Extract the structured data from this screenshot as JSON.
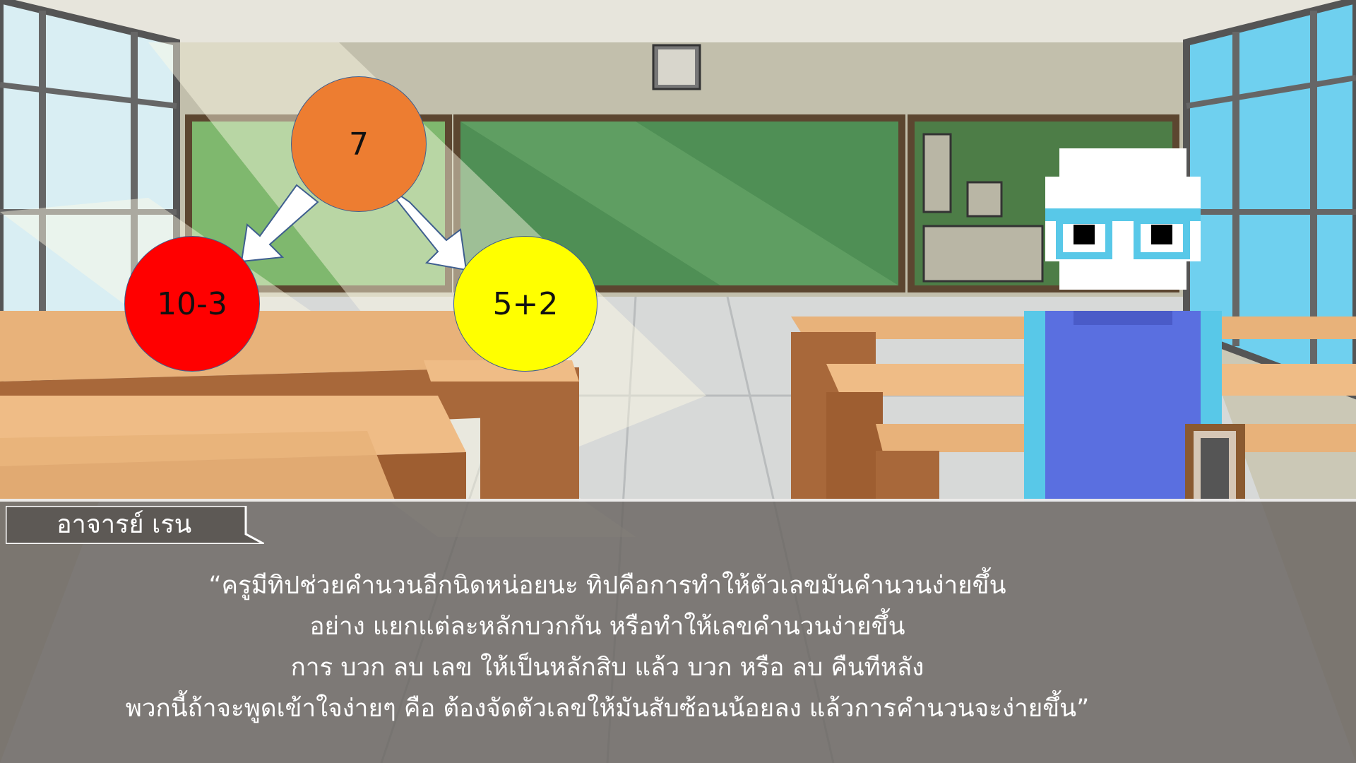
{
  "speaker": {
    "name": "อาจารย์ เรน"
  },
  "dialog": {
    "lines": [
      "“ครูมีทิปช่วยคำนวนอีกนิดหน่อยนะ ทิปคือการทำให้ตัวเลขมันคำนวนง่ายขึ้น",
      "อย่าง แยกแต่ละหลักบวกกัน หรือทำให้เลขคำนวนง่ายขึ้น",
      "การ บวก ลบ เลข ให้เป็นหลักสิบ แล้ว บวก หรือ ลบ คืนทีหลัง",
      "พวกนี้ถ้าจะพูดเข้าใจง่ายๆ คือ ต้องจัดตัวเลขให้มันสับซ้อนน้อยลง แล้วการคำนวนจะง่ายขึ้น”"
    ]
  },
  "number_diagram": {
    "top": {
      "label": "7",
      "color": "#ed7d31"
    },
    "left": {
      "label": "10-3",
      "color": "#ff0000"
    },
    "right": {
      "label": "5+2",
      "color": "#ffff00"
    }
  },
  "colors": {
    "wall": "#c9c6b5",
    "chalkboard": "#4f8f55",
    "desk_top": "#e8b27a",
    "desk_side": "#a8683a",
    "teacher_shirt": "#5a6fe0",
    "teacher_glasses": "#58c8e8"
  }
}
